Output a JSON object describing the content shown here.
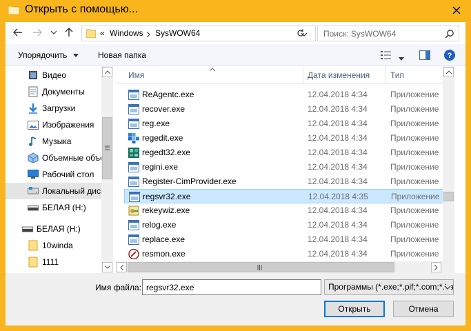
{
  "window": {
    "title": "Открыть с помощью..."
  },
  "address": {
    "prefix": "«",
    "segments": [
      "Windows",
      "SysWOW64"
    ]
  },
  "search": {
    "placeholder": "Поиск: SysWOW64"
  },
  "toolbar": {
    "organize_label": "Упорядочить",
    "new_folder_label": "Новая папка"
  },
  "sidebar": {
    "items": [
      {
        "label": "Видео",
        "icon": "video-icon"
      },
      {
        "label": "Документы",
        "icon": "documents-icon"
      },
      {
        "label": "Загрузки",
        "icon": "downloads-icon"
      },
      {
        "label": "Изображения",
        "icon": "pictures-icon"
      },
      {
        "label": "Музыка",
        "icon": "music-icon"
      },
      {
        "label": "Объемные объекты",
        "icon": "3d-objects-icon"
      },
      {
        "label": "Рабочий стол",
        "icon": "desktop-icon"
      },
      {
        "label": "Локальный диск",
        "icon": "local-disk-icon"
      },
      {
        "label": "БЕЛАЯ (H:)",
        "icon": "usb-drive-icon"
      },
      {
        "label": "БЕЛАЯ (H:)",
        "icon": "usb-drive-icon"
      },
      {
        "label": "10winda",
        "icon": "folder-icon"
      },
      {
        "label": "1111",
        "icon": "folder-icon"
      }
    ]
  },
  "columns": {
    "name": "Имя",
    "date": "Дата изменения",
    "type": "Тип"
  },
  "files": [
    {
      "name": "ReAgentc.exe",
      "date": "12.04.2018 4:34",
      "type": "Приложение",
      "icon": "exe-window-icon"
    },
    {
      "name": "recover.exe",
      "date": "12.04.2018 4:34",
      "type": "Приложение",
      "icon": "exe-window-icon"
    },
    {
      "name": "reg.exe",
      "date": "12.04.2018 4:34",
      "type": "Приложение",
      "icon": "exe-window-icon"
    },
    {
      "name": "regedit.exe",
      "date": "12.04.2018 4:34",
      "type": "Приложение",
      "icon": "regedit-icon"
    },
    {
      "name": "regedt32.exe",
      "date": "12.04.2018 4:34",
      "type": "Приложение",
      "icon": "regedt32-icon"
    },
    {
      "name": "regini.exe",
      "date": "12.04.2018 4:34",
      "type": "Приложение",
      "icon": "exe-window-icon"
    },
    {
      "name": "Register-CimProvider.exe",
      "date": "12.04.2018 4:34",
      "type": "Приложение",
      "icon": "exe-window-icon"
    },
    {
      "name": "regsvr32.exe",
      "date": "12.04.2018 4:35",
      "type": "Приложение",
      "icon": "exe-window-icon",
      "selected": true
    },
    {
      "name": "rekeywiz.exe",
      "date": "12.04.2018 4:34",
      "type": "Приложение",
      "icon": "rekeywiz-icon"
    },
    {
      "name": "relog.exe",
      "date": "12.04.2018 4:34",
      "type": "Приложение",
      "icon": "exe-window-icon"
    },
    {
      "name": "replace.exe",
      "date": "12.04.2018 4:34",
      "type": "Приложение",
      "icon": "exe-window-icon"
    },
    {
      "name": "resmon.exe",
      "date": "12.04.2018 4:34",
      "type": "Приложение",
      "icon": "resmon-icon"
    }
  ],
  "bottom": {
    "filename_label": "Имя файла:",
    "filename_value": "regsvr32.exe",
    "filter_value": "Программы (*.exe;*.pif;*.com;*.bat;*.cmd)",
    "open_label": "Открыть",
    "cancel_label": "Отмена"
  },
  "colors": {
    "title_bar": "#f8b51c",
    "selection": "#cce8ff",
    "accent": "#0078d7"
  }
}
